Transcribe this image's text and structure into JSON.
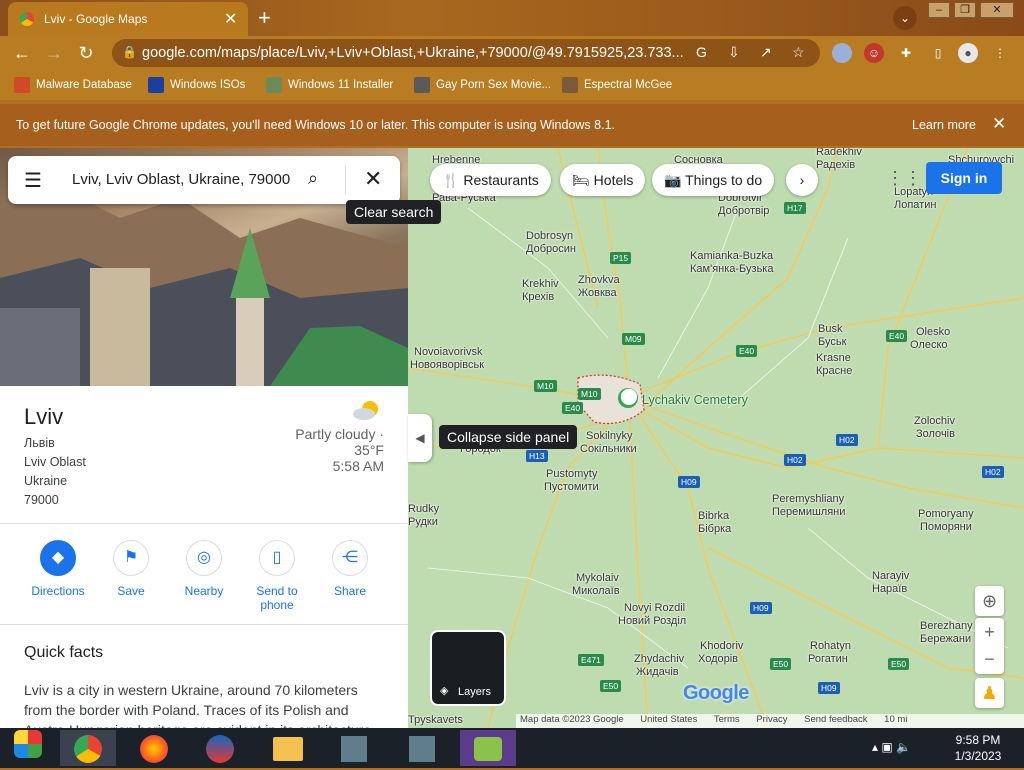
{
  "browser": {
    "tab_title": "Lviv - Google Maps",
    "url": "google.com/maps/place/Lviv,+Lviv+Oblast,+Ukraine,+79000/@49.7915925,23.733...",
    "bookmarks": [
      "Malware Database",
      "Windows ISOs",
      "Windows 11 Installer",
      "Gay Porn Sex Movie...",
      "Espectral McGee"
    ],
    "infobar_message": "To get future Google Chrome updates, you'll need Windows 10 or later. This computer is using Windows 8.1.",
    "infobar_link": "Learn more",
    "colors": {
      "frame": "#b87d22",
      "infobar": "#a65f1c"
    }
  },
  "maps": {
    "search_query": "Lviv, Lviv Oblast, Ukraine, 79000",
    "clear_search_tooltip": "Clear search",
    "collapse_tooltip": "Collapse side panel",
    "chips": [
      "Restaurants",
      "Hotels",
      "Things to do"
    ],
    "sign_in": "Sign in",
    "place": {
      "name": "Lviv",
      "address_lines": [
        "Львів",
        "Lviv Oblast",
        "Ukraine",
        "79000"
      ],
      "weather": "Partly cloudy · 35°F",
      "local_time": "5:58 AM"
    },
    "actions": [
      {
        "label": "Directions",
        "icon": "directions-icon"
      },
      {
        "label": "Save",
        "icon": "bookmark-icon"
      },
      {
        "label": "Nearby",
        "icon": "nearby-icon"
      },
      {
        "label": "Send to phone",
        "icon": "phone-icon"
      },
      {
        "label": "Share",
        "icon": "share-icon"
      }
    ],
    "quick_facts_title": "Quick facts",
    "quick_facts_text": "Lviv is a city in western Ukraine, around 70 kilometers from the border with Poland. Traces of its Polish and Austro-Hungarian heritage are evident in its architecture",
    "layers_label": "Layers",
    "map_labels": [
      "Hrebenne",
      "Сосновка",
      "Radekhiv",
      "Радехів",
      "Shchurovychi",
      "Рава-Руська",
      "Dobrotvir",
      "Добротвір",
      "Lopatyn",
      "Лопатин",
      "Dobrosyn",
      "Добросин",
      "Kamianka-Buzka",
      "Кам'янка-Бузька",
      "Zhovkva",
      "Жовква",
      "Krekhiv",
      "Крехів",
      "Busk",
      "Буськ",
      "Olesko",
      "Олеско",
      "Krasne",
      "Красне",
      "Novoiavorivsk",
      "Новояворівськ",
      "Lychakiv Cemetery",
      "Sokilnyky",
      "Сокільники",
      "Zolochiv",
      "Золочів",
      "Pustomyty",
      "Пустомити",
      "Городок",
      "Peremyshliany",
      "Перемишляни",
      "Rudky",
      "Рудки",
      "Bibrka",
      "Бібрка",
      "Pomoryany",
      "Поморяни",
      "Mykolaiv",
      "Миколаїв",
      "Narayiv",
      "Нараїв",
      "Novyi Rozdil",
      "Новий Розділ",
      "Berezhany",
      "Бережани",
      "Khodoriv",
      "Ходорів",
      "Rohatyn",
      "Рогатин",
      "Zhydachiv",
      "Жидачів",
      "Труskavets"
    ],
    "road_shields": [
      "H17",
      "P15",
      "M09",
      "E40",
      "E40",
      "M10",
      "M10",
      "E40",
      "H02",
      "H13",
      "H09",
      "H02",
      "H02",
      "H09",
      "E471",
      "E50",
      "E50",
      "E50",
      "H09"
    ],
    "google_logo": "Google",
    "attribution": [
      "Map data ©2023 Google",
      "United States",
      "Terms",
      "Privacy",
      "Send feedback",
      "10 mi"
    ]
  },
  "taskbar": {
    "time": "9:58 PM",
    "date": "1/3/2023"
  }
}
